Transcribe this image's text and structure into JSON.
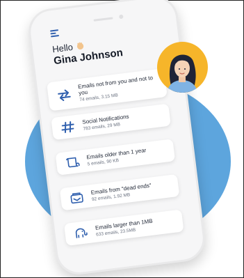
{
  "greeting": "Hello",
  "user_name": "Gina Johnson",
  "cards": [
    {
      "title": "Emails not from you and not to you",
      "meta": "74 emails, 3.15 MB",
      "icon": "swap-arrows-icon"
    },
    {
      "title": "Social Notifications",
      "meta": "783 emails, 29 MB",
      "icon": "hashtag-icon"
    },
    {
      "title": "Emails older than 1 year",
      "meta": "5 emails, 90 KB",
      "icon": "scroll-icon"
    },
    {
      "title": "Emails from \"dead ends\"",
      "meta": "92 emails, 1.92 MB",
      "icon": "inbox-cards-icon"
    },
    {
      "title": "Emails larger than 1MB",
      "meta": "633 emails, 23.5MB",
      "icon": "elephant-icon"
    }
  ],
  "colors": {
    "accent": "#2f5fae",
    "blob": "#5da5dd",
    "avatar_bg": "#f6b52a"
  }
}
